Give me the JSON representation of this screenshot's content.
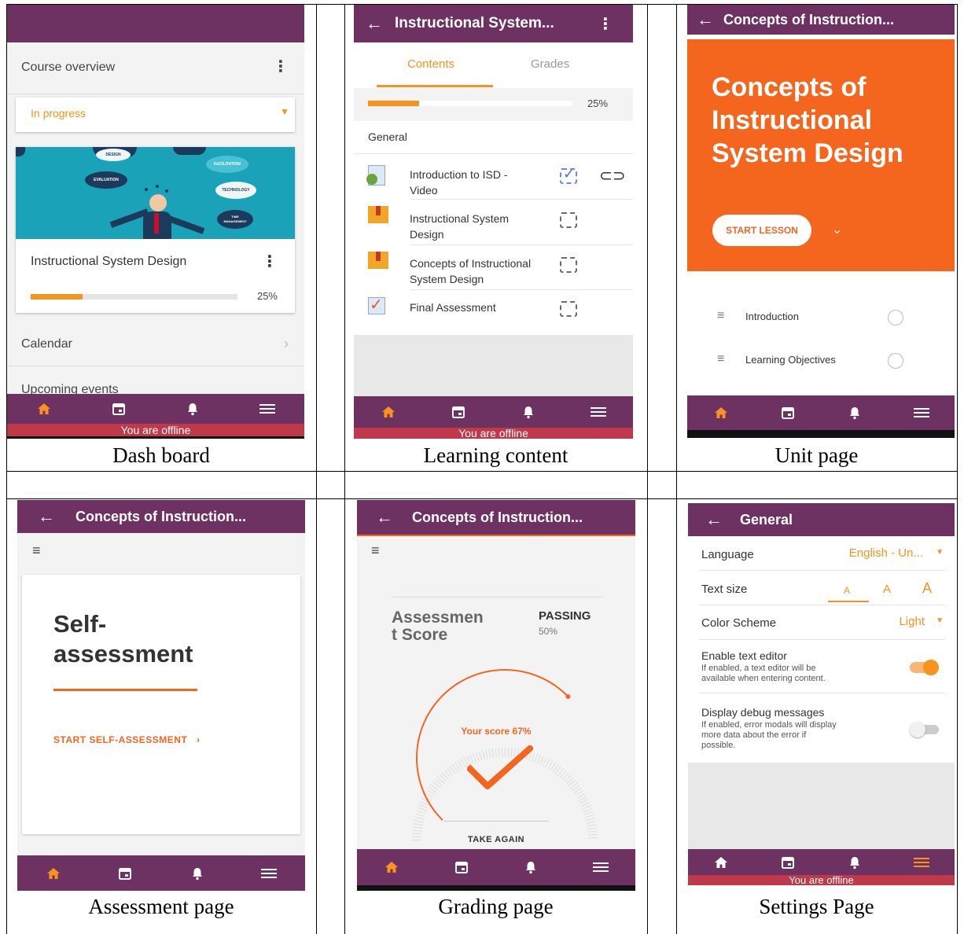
{
  "captions": [
    "Dash board",
    "Learning content",
    "Unit page",
    "Assessment page",
    "Grading page",
    "Settings Page"
  ],
  "offline_text": "You are offline",
  "colors": {
    "purple": "#6d3262",
    "orange": "#f7931e",
    "deep_orange": "#f4661e",
    "offline_red": "#c0394b"
  },
  "dashboard": {
    "course_overview": "Course overview",
    "filter_value": "In progress",
    "course_name": "Instructional System Design",
    "progress_text": "25%",
    "progress": 0.25,
    "image_bubbles": [
      "DESIGN",
      "FACILITATION",
      "EVALUATION",
      "TECHNOLOGY",
      "TIME MANAGEMENT"
    ],
    "calendar": "Calendar",
    "upcoming": "Upcoming events"
  },
  "learning": {
    "title": "Instructional System...",
    "tab_contents": "Contents",
    "tab_grades": "Grades",
    "progress_text": "25%",
    "progress": 0.25,
    "section": "General",
    "items": [
      {
        "line1": "Introduction to ISD -",
        "line2": "Video",
        "icon": "video-file-icon",
        "checked": true
      },
      {
        "line1": "Instructional System",
        "line2": "Design",
        "icon": "package-icon",
        "checked": false
      },
      {
        "line1": "Concepts of Instructional",
        "line2": "System Design",
        "icon": "package-icon",
        "checked": false
      },
      {
        "line1": "Final Assessment",
        "line2": "",
        "icon": "quiz-icon",
        "checked": false
      }
    ]
  },
  "unit": {
    "title": "Concepts of Instruction...",
    "hero_line1": "Concepts of",
    "hero_line2": "Instructional",
    "hero_line3": "System Design",
    "start": "START LESSON",
    "items": [
      "Introduction",
      "Learning Objectives"
    ]
  },
  "assessment": {
    "title": "Concepts of Instruction...",
    "heading_line1": "Self-",
    "heading_line2": "assessment",
    "start": "START SELF-ASSESSMENT"
  },
  "grading": {
    "title": "Concepts of Instruction...",
    "score_line1": "Assessmen",
    "score_line2": "t Score",
    "passing": "PASSING",
    "passing_pct": "50%",
    "your_score": "Your score 67%",
    "score": 0.67,
    "take_again": "TAKE AGAIN"
  },
  "settings": {
    "title": "General",
    "language_label": "Language",
    "language_value": "English - Un...",
    "textsize_label": "Text size",
    "textsize_options": [
      "A",
      "A",
      "A"
    ],
    "scheme_label": "Color Scheme",
    "scheme_value": "Light",
    "editor_label": "Enable text editor",
    "editor_desc1": "If enabled, a text editor will be",
    "editor_desc2": "available when entering content.",
    "editor_on": true,
    "debug_label": "Display debug messages",
    "debug_desc1": "If enabled, error modals will display",
    "debug_desc2": "more data about the error if",
    "debug_desc3": "possible.",
    "debug_on": false
  }
}
